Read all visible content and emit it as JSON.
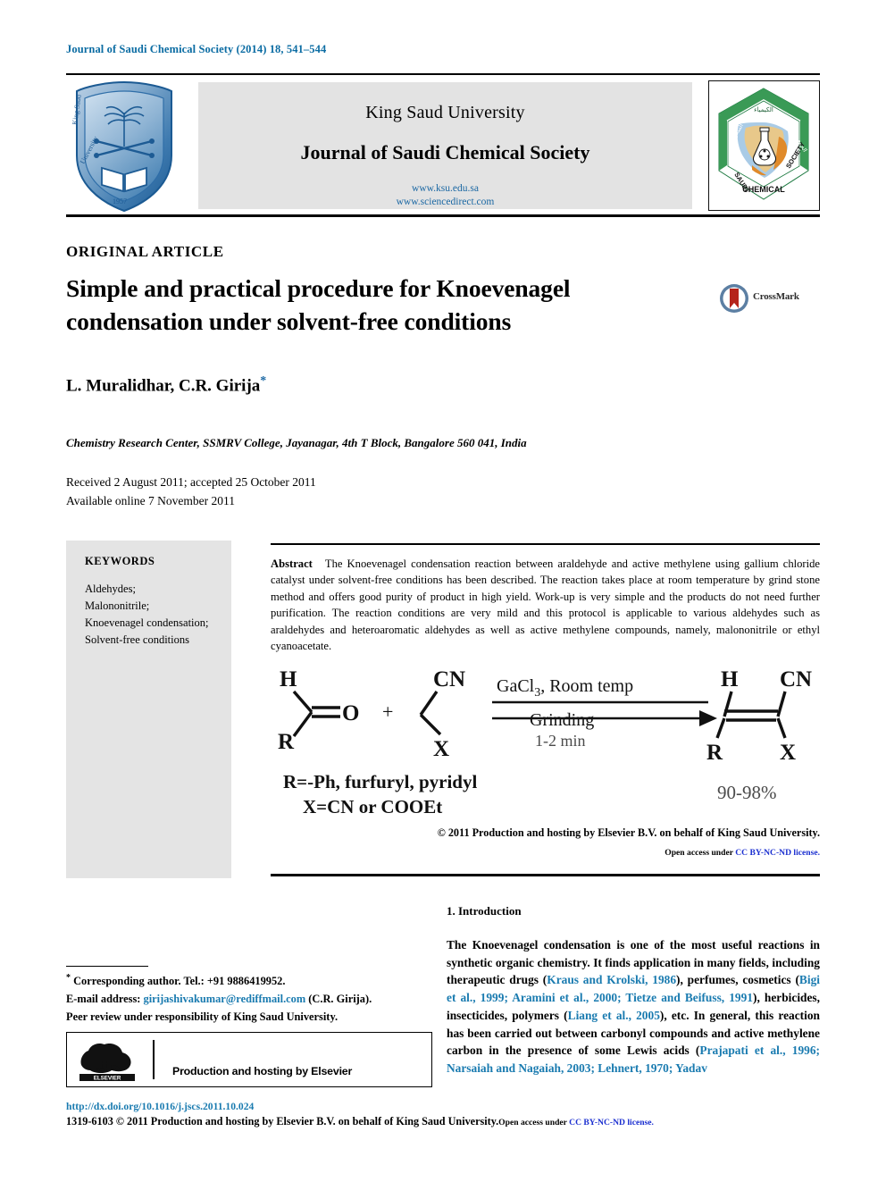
{
  "running_head": "Journal of Saudi Chemical Society (2014) 18, 541–544",
  "masthead": {
    "ksu_logo_name": "king-saud-university-shield-logo",
    "ksu_logo_text": "King Saud University 1957",
    "university": "King Saud University",
    "journal_title": "Journal of Saudi Chemical Society",
    "url_ksu": "www.ksu.edu.sa",
    "url_sciencedirect": "www.sciencedirect.com",
    "scs_logo_name": "saudi-chemical-society-hexagon-logo",
    "scs_logo_text_left": "SAUDI",
    "scs_logo_text_right": "SOCIETY",
    "scs_logo_text_bottom": "CHEMICAL"
  },
  "article": {
    "type_label": "ORIGINAL ARTICLE",
    "title": "Simple and practical procedure for Knoevenagel condensation under solvent-free conditions",
    "authors": "L. Muralidhar, C.R. Girija",
    "author_star": "*",
    "affiliation": "Chemistry Research Center, SSMRV College, Jayanagar, 4th T Block, Bangalore 560 041, India",
    "received": "Received 2 August 2011; accepted 25 October 2011",
    "available": "Available online 7 November 2011",
    "crossmark_label": "CrossMark"
  },
  "keywords": {
    "heading": "KEYWORDS",
    "items": [
      "Aldehydes;",
      "Malononitrile;",
      "Knoevenagel condensation;",
      "Solvent-free conditions"
    ]
  },
  "abstract": {
    "label": "Abstract",
    "text": "The Knoevenagel condensation reaction between araldehyde and active methylene using gallium chloride catalyst under solvent-free conditions has been described. The reaction takes place at room temperature by grind stone method and offers good purity of product in high yield. Work-up is very simple and the products do not need further purification. The reaction conditions are very mild and this protocol is applicable to various aldehydes such as araldehydes and heteroaromatic aldehydes as well as active methylene compounds, namely, malononitrile or ethyl cyanoacetate."
  },
  "scheme": {
    "reactant1_h": "H",
    "reactant1_r": "R",
    "reactant1_o": "O",
    "plus": "+",
    "reactant2_cn": "CN",
    "reactant2_x": "X",
    "condition_line1": "GaCl",
    "condition_line1_sub": "3",
    "condition_line1_rest": ",  Room temp",
    "condition_line2": "Grinding",
    "condition_line3": "1-2 min",
    "product_h": "H",
    "product_cn": "CN",
    "product_r": "R",
    "product_x": "X",
    "yield": "90-98%",
    "legend_r": "R=-Ph, furfuryl, pyridyl",
    "legend_x": "X=CN or COOEt"
  },
  "copyright": {
    "line": "© 2011 Production and hosting by Elsevier B.V. on behalf of King Saud University.",
    "open_access_prefix": "Open access under ",
    "license": "CC BY-NC-ND license."
  },
  "introduction": {
    "heading": "1. Introduction",
    "paragraph_parts": [
      {
        "t": "The Knoevenagel condensation is one of the most useful reactions in synthetic organic chemistry. It finds application in many fields, including therapeutic drugs (",
        "c": false
      },
      {
        "t": "Kraus and Krolski, 1986",
        "c": true
      },
      {
        "t": "), perfumes, cosmetics (",
        "c": false
      },
      {
        "t": "Bigi et al., 1999; Aramini et al., 2000; Tietze and Beifuss, 1991",
        "c": true
      },
      {
        "t": "), herbicides, insecticides, polymers (",
        "c": false
      },
      {
        "t": "Liang et al., 2005",
        "c": true
      },
      {
        "t": "), etc. In general, this reaction has been carried out between carbonyl compounds and active methylene carbon in the presence of some Lewis acids (",
        "c": false
      },
      {
        "t": "Prajapati et al., 1996; Narsaiah and Nagaiah, 2003; Lehnert, 1970; Yadav",
        "c": true
      }
    ]
  },
  "footnotes": {
    "corresponding_star": "*",
    "corresponding": "Corresponding author. Tel.: +91 9886419952.",
    "email_label": "E-mail address:",
    "email": "girijashivakumar@rediffmail.com",
    "email_suffix": "(C.R. Girija).",
    "peer_review": "Peer review under responsibility of King Saud University.",
    "elsevier_box_text": "Production and hosting by Elsevier",
    "elsevier_logo_name": "elsevier-tree-logo",
    "elsevier_wordmark": "ELSEVIER"
  },
  "bottom": {
    "doi": "http://dx.doi.org/10.1016/j.jscs.2011.10.024",
    "issn_main": "1319-6103 © 2011 Production and hosting by Elsevier B.V. on behalf of King Saud University.",
    "issn_open_access": "Open access under ",
    "issn_license": "CC BY-NC-ND license."
  },
  "colors": {
    "link_blue": "#1a7bb0",
    "header_blue": "#0b6ca3",
    "license_blue": "#1b2fd0",
    "keyword_bg": "#e4e4e4",
    "masthead_bg": "#e3e3e3"
  }
}
